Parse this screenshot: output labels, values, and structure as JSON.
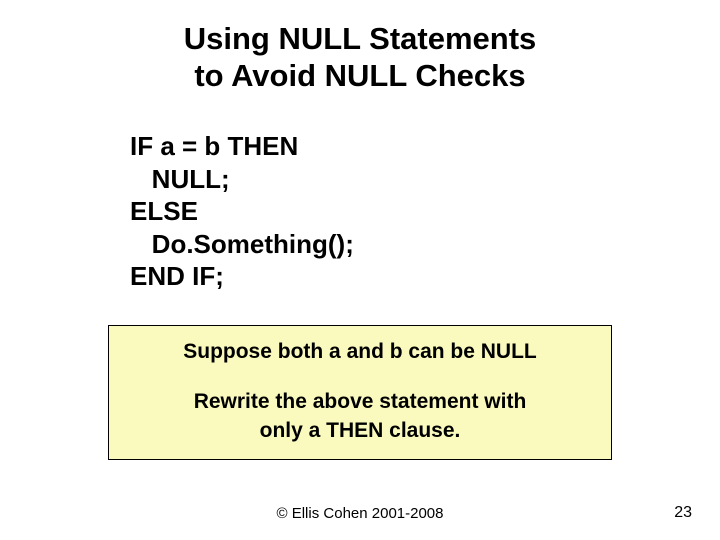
{
  "title": "Using NULL Statements\nto Avoid NULL Checks",
  "code": {
    "l1": "IF a = b THEN",
    "l2": "   NULL;",
    "l3": "ELSE",
    "l4": "   Do.Something();",
    "l5": "END IF;"
  },
  "callout": {
    "line1": "Suppose both a and b can be NULL",
    "line2": "Rewrite the above statement with",
    "line3": "only a THEN clause."
  },
  "footer": "© Ellis Cohen 2001-2008",
  "page_number": "23"
}
